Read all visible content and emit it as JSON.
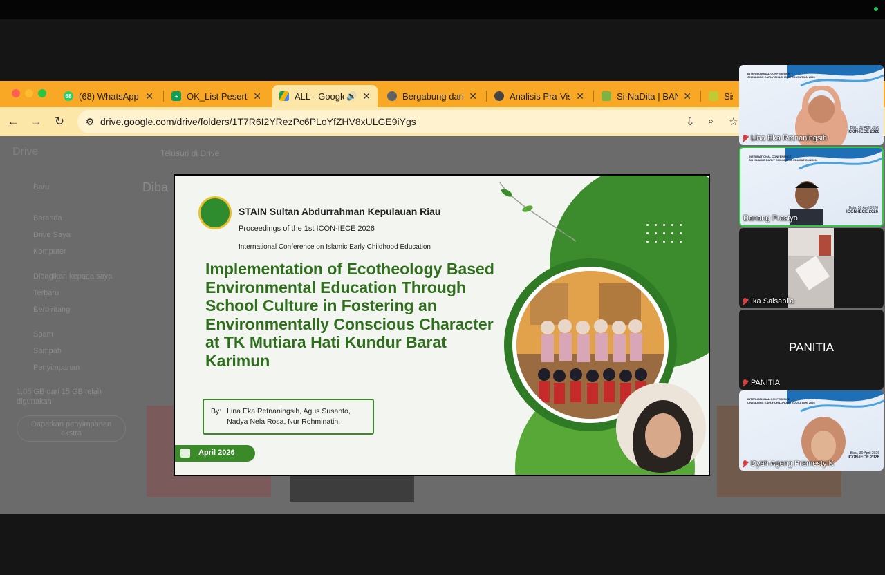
{
  "browser": {
    "tabs": [
      {
        "title": "(68) WhatsApp",
        "badge": "68",
        "color": "#25d366"
      },
      {
        "title": "OK_List Peserta",
        "color": "#0f9d58"
      },
      {
        "title": "ALL - Google",
        "color": "#4285f4",
        "active": true
      },
      {
        "title": "Bergabung dari",
        "color": "#5f6368"
      },
      {
        "title": "Analisis Pra-Visi",
        "color": "#444"
      },
      {
        "title": "Si-NaDita | BAN",
        "color": "#7cb342"
      },
      {
        "title": "Sisp",
        "color": "#c0ca33"
      }
    ],
    "url": "drive.google.com/drive/folders/1T7R6I2YRezPc6PLoYfZHV8xULGE9iYgs"
  },
  "drive": {
    "app_name": "Drive",
    "search_placeholder": "Telusuri di Drive",
    "new_label": "Baru",
    "nav": [
      "Beranda",
      "Drive Saya",
      "Komputer",
      "Dibagikan kepada saya",
      "Terbaru",
      "Berbintang",
      "Spam",
      "Sampah",
      "Penyimpanan"
    ],
    "storage_text": "1,05 GB dari 15 GB telah digunakan",
    "storage_button": "Dapatkan penyimpanan ekstra",
    "heading_fragment": "Diba"
  },
  "slide": {
    "institution": "STAIN Sultan Abdurrahman Kepulauan Riau",
    "proceedings": "Proceedings of the 1st ICON-IECE 2026",
    "conference": "International Conference on Islamic Early Childhood Education",
    "paper_title": "Implementation of Ecotheology Based Environmental Education Through School Culture in Fostering an Environmentally Conscious Character at TK Mutiara Hati Kundur Barat Karimun",
    "by_label": "By:",
    "authors": "Lina Eka Retnaningsih, Agus Susanto, Nadya Nela Rosa, Nur Rohminatin.",
    "date": "April 2026"
  },
  "participants": [
    {
      "name": "Lina Eka Retnaningsih",
      "muted": true,
      "background": true
    },
    {
      "name": "Danang Prastyo",
      "muted": false,
      "speaking": true,
      "background": true
    },
    {
      "name": "Ika Salsabila",
      "muted": true,
      "background": false
    },
    {
      "name": "PANITIA",
      "muted": true,
      "label": "PANITIA",
      "background": false
    },
    {
      "name": "Dyah Ageng Pramesty K",
      "muted": true,
      "background": true
    }
  ],
  "bg_text": {
    "conf_line1": "INTERNATIONAL CONFERENCE",
    "conf_line2": "ON ISLAMIC EARLY CHILDHOOD EDUCATION 2026",
    "date": "Batu, 30 April 2026",
    "code": "ICON-IECE 2026"
  }
}
